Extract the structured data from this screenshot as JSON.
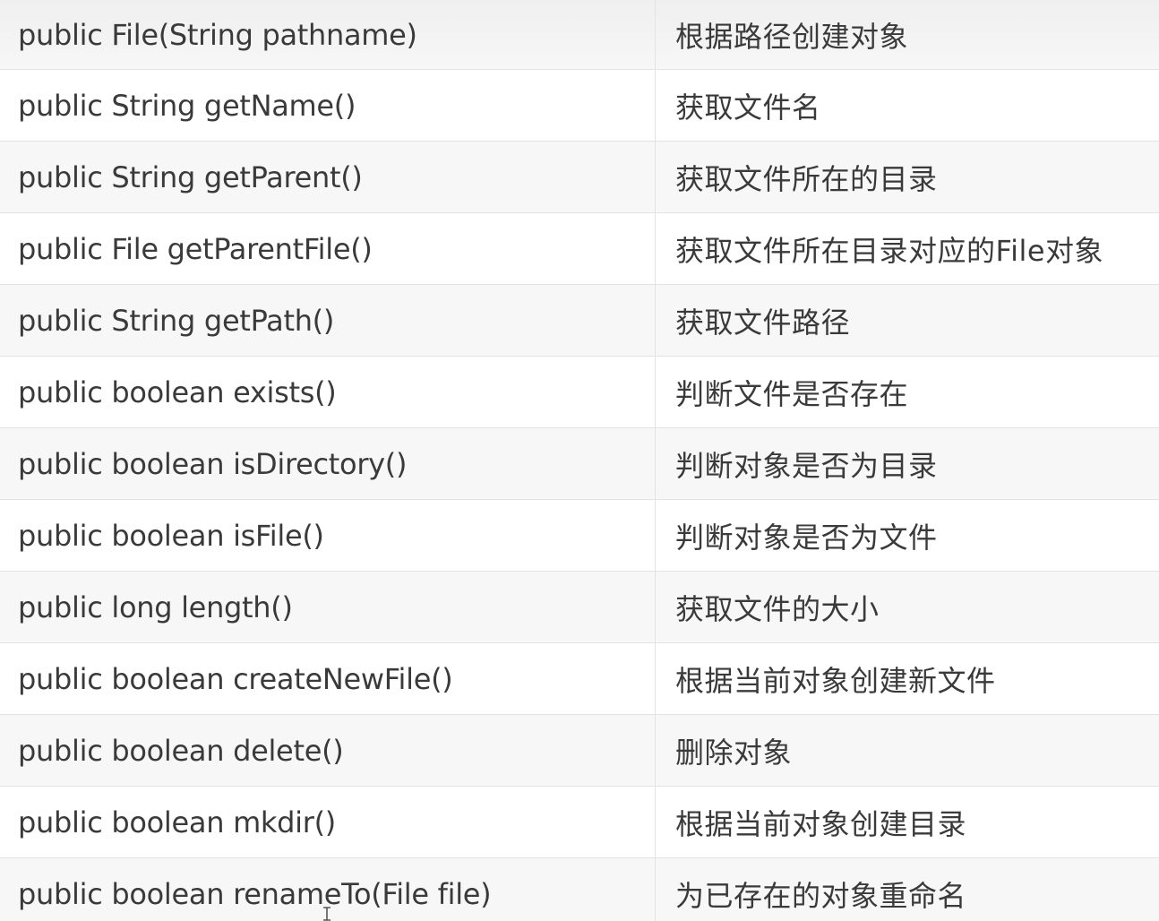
{
  "rows": [
    {
      "method": "public File(String pathname)",
      "desc": "根据路径创建对象"
    },
    {
      "method": "public String getName()",
      "desc": "获取文件名"
    },
    {
      "method": "public String getParent()",
      "desc": "获取文件所在的目录"
    },
    {
      "method": "public File getParentFile()",
      "desc": "获取文件所在目录对应的File对象"
    },
    {
      "method": "public String getPath()",
      "desc": "获取文件路径"
    },
    {
      "method": "public boolean exists()",
      "desc": "判断文件是否存在"
    },
    {
      "method": "public boolean isDirectory()",
      "desc": "判断对象是否为目录"
    },
    {
      "method": "public boolean isFile()",
      "desc": "判断对象是否为文件"
    },
    {
      "method": "public long length()",
      "desc": "获取文件的大小"
    },
    {
      "method": "public boolean createNewFile()",
      "desc": "根据当前对象创建新文件"
    },
    {
      "method": "public boolean delete()",
      "desc": "删除对象"
    },
    {
      "method": "public boolean mkdir()",
      "desc": "根据当前对象创建目录"
    },
    {
      "method": "public boolean renameTo(File file)",
      "desc": "为已存在的对象重命名"
    }
  ],
  "colors": {
    "text": "#3a3a3a",
    "stripe": "#f7f7f7",
    "border": "#e3e3e3"
  },
  "cursor_icon": "text-cursor-icon"
}
